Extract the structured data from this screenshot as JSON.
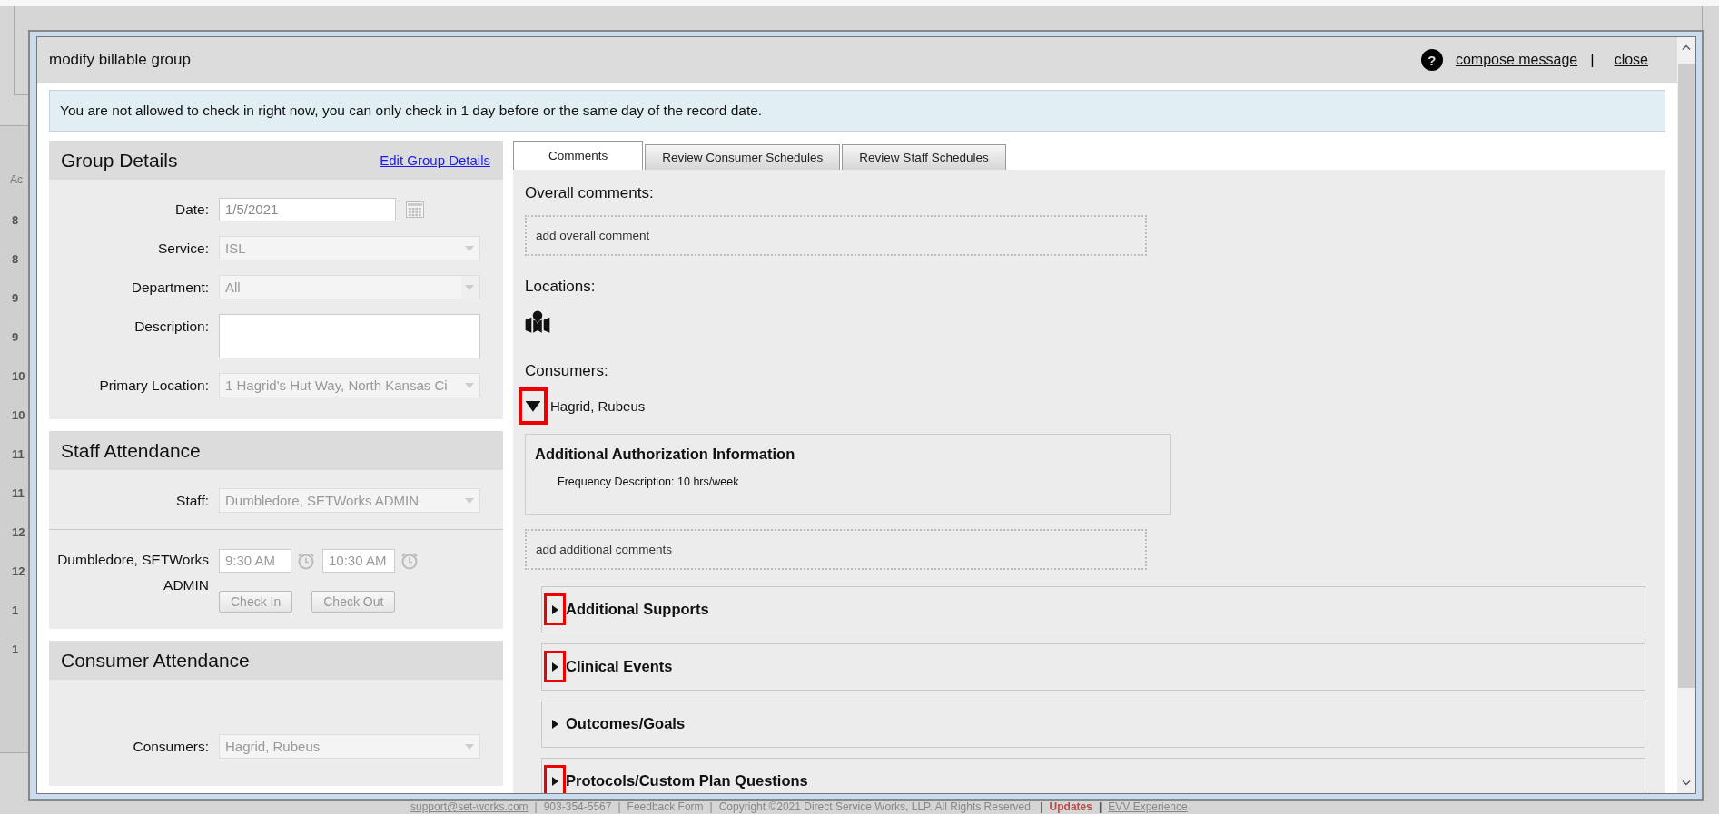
{
  "background": {
    "column_header": "Ac",
    "times": [
      "8",
      "8",
      "9",
      "9",
      "10",
      "10",
      "11",
      "11",
      "12",
      "12",
      "1",
      "1"
    ],
    "footer": [
      {
        "text": "support@set-works.com",
        "kind": "link"
      },
      {
        "text": "|",
        "kind": "separator"
      },
      {
        "text": "903-354-5567",
        "kind": "text"
      },
      {
        "text": "|",
        "kind": "separator"
      },
      {
        "text": "Feedback Form",
        "kind": "text"
      },
      {
        "text": "|",
        "kind": "separator"
      },
      {
        "text": "Copyright ©2021 Direct Service Works, LLP. All Rights Reserved.",
        "kind": "text"
      },
      {
        "text": "|",
        "kind": "strong-separator"
      },
      {
        "text": "Updates",
        "kind": "highlight"
      },
      {
        "text": "|",
        "kind": "strong-separator"
      },
      {
        "text": "EVV Experience",
        "kind": "link"
      }
    ]
  },
  "modal": {
    "title": "modify billable group",
    "help": "?",
    "compose": "compose message",
    "separator": "|",
    "close": "close",
    "alert": "You are not allowed to check in right now, you can only check in 1 day before or the same day of the record date.",
    "group_details": {
      "heading": "Group Details",
      "edit_link": "Edit Group Details",
      "fields": [
        {
          "label": "Date:",
          "kind": "date",
          "value": "1/5/2021"
        },
        {
          "label": "Service:",
          "kind": "select",
          "value": "ISL",
          "disabled": true
        },
        {
          "label": "Department:",
          "kind": "combo",
          "value": "All",
          "disabled": true
        },
        {
          "label": "Description:",
          "kind": "textarea"
        },
        {
          "label": "Primary Location:",
          "kind": "select",
          "value": "1 Hagrid's Hut Way, North Kansas Ci",
          "disabled": true
        }
      ]
    },
    "staff_attendance": {
      "heading": "Staff Attendance",
      "staff_label": "Staff:",
      "staff_value": "Dumbledore, SETWorks ADMIN",
      "staff_disabled": true,
      "row_label": "Dumbledore, SETWorks ADMIN",
      "check_in_time": "9:30 AM",
      "check_out_time": "10:30 AM",
      "buttons": [
        {
          "label": "Check In",
          "disabled": true
        },
        {
          "label": "Check Out",
          "disabled": true
        }
      ]
    },
    "consumer_attendance": {
      "heading": "Consumer Attendance",
      "consumers_label": "Consumers:",
      "consumers_value": "Hagrid, Rubeus",
      "consumers_disabled": true
    },
    "tabs": [
      {
        "label": "Comments",
        "selected": true
      },
      {
        "label": "Review Consumer Schedules",
        "selected": false
      },
      {
        "label": "Review Staff Schedules",
        "selected": false
      }
    ],
    "comments": {
      "overall_label": "Overall comments:",
      "overall_placeholder": "add overall comment",
      "locations_label": "Locations:",
      "consumers_label": "Consumers:",
      "consumer": {
        "name": "Hagrid, Rubeus",
        "expanded": true,
        "highlighted": true
      },
      "authorization": {
        "heading": "Additional Authorization Information",
        "frequency": "Frequency Description: 10 hrs/week"
      },
      "additional_placeholder": "add additional comments",
      "sections": [
        {
          "title": "Additional Supports",
          "expanded": false,
          "highlighted": true
        },
        {
          "title": "Clinical Events",
          "expanded": false,
          "highlighted": true
        },
        {
          "title": "Outcomes/Goals",
          "expanded": false,
          "highlighted": false
        },
        {
          "title": "Protocols/Custom Plan Questions",
          "expanded": false,
          "highlighted": true
        }
      ]
    }
  }
}
